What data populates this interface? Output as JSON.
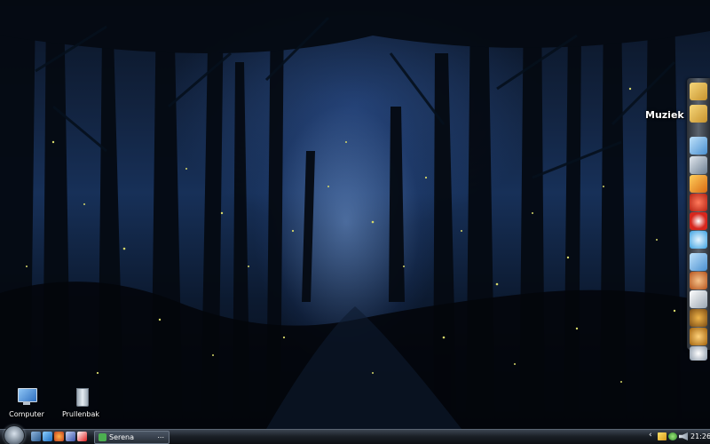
{
  "desktop": {
    "icons": [
      {
        "label": "Computer",
        "icon": "computer-icon"
      },
      {
        "label": "Prullenbak",
        "icon": "recycle-bin-icon"
      }
    ]
  },
  "dock": {
    "hover_label": "Muziek",
    "items": [
      "music-folder-icon",
      "folder-icon",
      "folder-icon",
      "tools-icon",
      "flash-icon",
      "ccleaner-icon",
      "browser-icon",
      "messenger-icon",
      "folder-icon",
      "tf2-icon",
      "steam-icon",
      "unreal-icon",
      "badge-icon",
      "disc-icon"
    ]
  },
  "taskbar": {
    "quick_launch": [
      "show-desktop-icon",
      "ie-icon",
      "firefox-icon",
      "media-icon",
      "app-icon"
    ],
    "tasks": [
      {
        "label": "Serena",
        "icon": "app-icon",
        "dots": "..."
      }
    ],
    "tray": [
      "chevron-icon",
      "network-icon",
      "people-icon",
      "volume-icon"
    ],
    "clock": "21:26"
  },
  "colors": {
    "taskbar": "#1a1f26",
    "accent": "#4caf50"
  }
}
